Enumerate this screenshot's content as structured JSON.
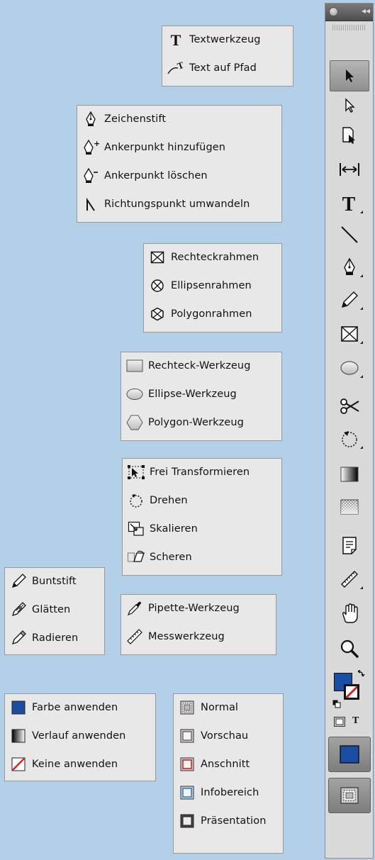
{
  "flyouts": {
    "type": [
      "Textwerkzeug",
      "Text auf Pfad"
    ],
    "pen": [
      "Zeichenstift",
      "Ankerpunkt hinzufügen",
      "Ankerpunkt löschen",
      "Richtungspunkt umwandeln"
    ],
    "frame": [
      "Rechteckrahmen",
      "Ellipsenrahmen",
      "Polygonrahmen"
    ],
    "shape": [
      "Rechteck-Werkzeug",
      "Ellipse-Werkzeug",
      "Polygon-Werkzeug"
    ],
    "transform": [
      "Frei Transformieren",
      "Drehen",
      "Skalieren",
      "Scheren"
    ],
    "pencil": [
      "Buntstift",
      "Glätten",
      "Radieren"
    ],
    "eyedropper": [
      "Pipette-Werkzeug",
      "Messwerkzeug"
    ],
    "apply": [
      "Farbe anwenden",
      "Verlauf anwenden",
      "Keine anwenden"
    ],
    "view": [
      "Normal",
      "Vorschau",
      "Anschnitt",
      "Infobereich",
      "Präsentation"
    ]
  },
  "toolbox": {
    "type_toggle_glyph": "T",
    "tools": [
      "selection-tool",
      "direct-selection-tool",
      "page-tool",
      "gap-tool",
      "type-tool",
      "line-tool",
      "pen-tool",
      "pencil-tool",
      "rectangle-frame-tool",
      "ellipse-tool",
      "scissors-tool",
      "free-transform-tool",
      "gradient-swatch-tool",
      "gradient-feather-tool",
      "note-tool",
      "measure-tool",
      "hand-tool",
      "zoom-tool"
    ]
  },
  "colors": {
    "background": "#b4cfe8",
    "flyout_bg": "#e8e8e8",
    "fill_blue": "#1b4ea3",
    "none_red": "#e02020"
  }
}
